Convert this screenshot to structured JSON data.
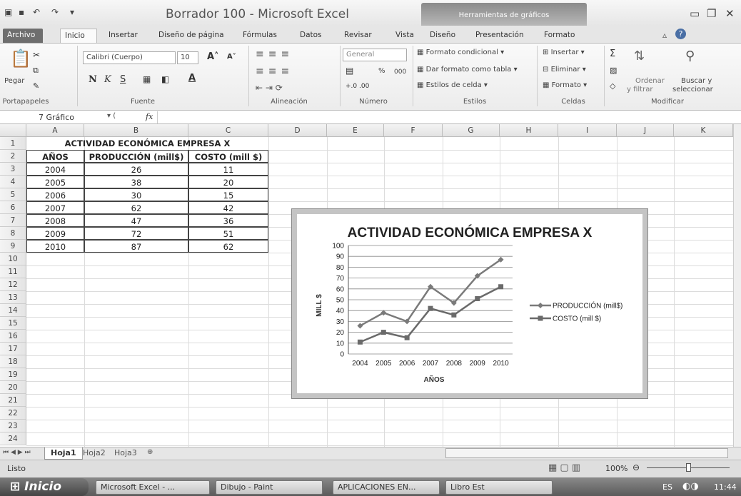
{
  "window": {
    "title": "Borrador 100  -  Microsoft Excel",
    "contextual_tab": "Herramientas de gráficos"
  },
  "tabs": [
    "Archivo",
    "Inicio",
    "Insertar",
    "Diseño de página",
    "Fórmulas",
    "Datos",
    "Revisar",
    "Vista",
    "Diseño",
    "Presentación",
    "Formato"
  ],
  "ribbon": {
    "clipboard": {
      "paste": "Pegar",
      "label": "Portapapeles"
    },
    "font": {
      "name": "Calibri (Cuerpo)",
      "size": "10",
      "label": "Fuente",
      "bold": "N",
      "italic": "K",
      "underline": "S"
    },
    "alignment": {
      "label": "Alineación"
    },
    "number": {
      "format": "General",
      "label": "Número",
      "percent": "%",
      "thousands": "000"
    },
    "styles": {
      "conditional": "Formato condicional",
      "table": "Dar formato como tabla",
      "cell_styles": "Estilos de celda",
      "label": "Estilos"
    },
    "cells": {
      "insert": "Insertar",
      "delete": "Eliminar",
      "format": "Formato",
      "label": "Celdas"
    },
    "editing": {
      "sigma": "Σ",
      "sort": "Ordenar",
      "sort2": "y filtrar",
      "find": "Buscar y",
      "find2": "seleccionar",
      "label": "Modificar"
    }
  },
  "formula_bar": {
    "name_box": "7 Gráfico",
    "fx": "fx",
    "content": ""
  },
  "columns": [
    "A",
    "B",
    "C",
    "D",
    "E",
    "F",
    "G",
    "H",
    "I",
    "J",
    "K"
  ],
  "rows": [
    "1",
    "2",
    "3",
    "4",
    "5",
    "6",
    "7",
    "8",
    "9",
    "10",
    "11",
    "12",
    "13",
    "14",
    "15",
    "16",
    "17",
    "18",
    "19",
    "20",
    "21",
    "22",
    "23",
    "24"
  ],
  "sheet": {
    "title": "ACTIVIDAD ECONÓMICA  EMPRESA X",
    "headers": [
      "AÑOS",
      "PRODUCCIÓN (mill$)",
      "COSTO (mill $)"
    ],
    "data": [
      [
        "2004",
        "26",
        "11"
      ],
      [
        "2005",
        "38",
        "20"
      ],
      [
        "2006",
        "30",
        "15"
      ],
      [
        "2007",
        "62",
        "42"
      ],
      [
        "2008",
        "47",
        "36"
      ],
      [
        "2009",
        "72",
        "51"
      ],
      [
        "2010",
        "87",
        "62"
      ]
    ]
  },
  "chart_data": {
    "type": "line",
    "title": "ACTIVIDAD ECONÓMICA  EMPRESA X",
    "xlabel": "AÑOS",
    "ylabel": "MILL $",
    "categories": [
      "2004",
      "2005",
      "2006",
      "2007",
      "2008",
      "2009",
      "2010"
    ],
    "ylim": [
      0,
      100
    ],
    "yticks": [
      "0",
      "10",
      "20",
      "30",
      "40",
      "50",
      "60",
      "70",
      "80",
      "90",
      "100"
    ],
    "grid": true,
    "legend": "right",
    "series": [
      {
        "name": "PRODUCCIÓN (mill$)",
        "values": [
          26,
          38,
          30,
          62,
          47,
          72,
          87
        ],
        "marker": "diamond",
        "color": "#7a7a7a"
      },
      {
        "name": "COSTO (mill $)",
        "values": [
          11,
          20,
          15,
          42,
          36,
          51,
          62
        ],
        "marker": "square",
        "color": "#6a6a6a"
      }
    ]
  },
  "sheet_tabs": [
    "Hoja1",
    "Hoja2",
    "Hoja3"
  ],
  "status": {
    "ready": "Listo",
    "zoom": "100%"
  },
  "taskbar": {
    "start": "Inicio",
    "items": [
      "Microsoft Excel - ...",
      "Dibujo - Paint",
      "APLICACIONES EN...",
      "Libro Est"
    ],
    "lang": "ES",
    "time": "11:44"
  }
}
